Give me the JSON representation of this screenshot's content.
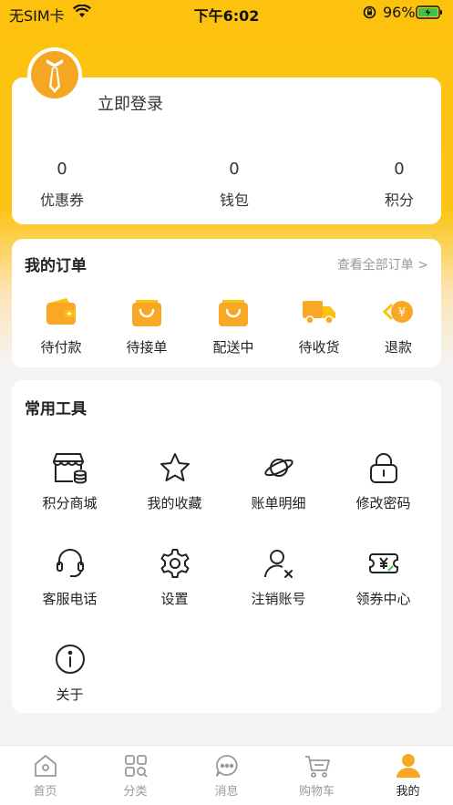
{
  "status_bar": {
    "carrier": "无SIM卡",
    "time": "下午6:02",
    "battery": "96%"
  },
  "profile": {
    "login_label": "立即登录",
    "stats": [
      {
        "value": "0",
        "label": "优惠券"
      },
      {
        "value": "0",
        "label": "钱包"
      },
      {
        "value": "0",
        "label": "积分"
      }
    ]
  },
  "orders": {
    "title": "我的订单",
    "view_all": "查看全部订单 >",
    "items": [
      {
        "label": "待付款",
        "icon": "wallet-icon"
      },
      {
        "label": "待接单",
        "icon": "shopping-bag-icon"
      },
      {
        "label": "配送中",
        "icon": "shopping-bag-icon"
      },
      {
        "label": "待收货",
        "icon": "truck-icon"
      },
      {
        "label": "退款",
        "icon": "refund-icon"
      }
    ]
  },
  "tools": {
    "title": "常用工具",
    "items": [
      {
        "label": "积分商城",
        "icon": "store-icon"
      },
      {
        "label": "我的收藏",
        "icon": "star-icon"
      },
      {
        "label": "账单明细",
        "icon": "planet-icon"
      },
      {
        "label": "修改密码",
        "icon": "lock-icon"
      },
      {
        "label": "客服电话",
        "icon": "headset-icon"
      },
      {
        "label": "设置",
        "icon": "gear-icon"
      },
      {
        "label": "注销账号",
        "icon": "user-remove-icon"
      },
      {
        "label": "领券中心",
        "icon": "coupon-icon"
      },
      {
        "label": "关于",
        "icon": "info-icon"
      }
    ]
  },
  "tab_bar": {
    "items": [
      {
        "label": "首页",
        "icon": "home-icon"
      },
      {
        "label": "分类",
        "icon": "category-icon"
      },
      {
        "label": "消息",
        "icon": "message-icon"
      },
      {
        "label": "购物车",
        "icon": "cart-icon"
      },
      {
        "label": "我的",
        "icon": "user-icon",
        "active": true
      }
    ]
  },
  "colors": {
    "brand": "#fcc20d",
    "accent_orange": "#f9a825"
  }
}
